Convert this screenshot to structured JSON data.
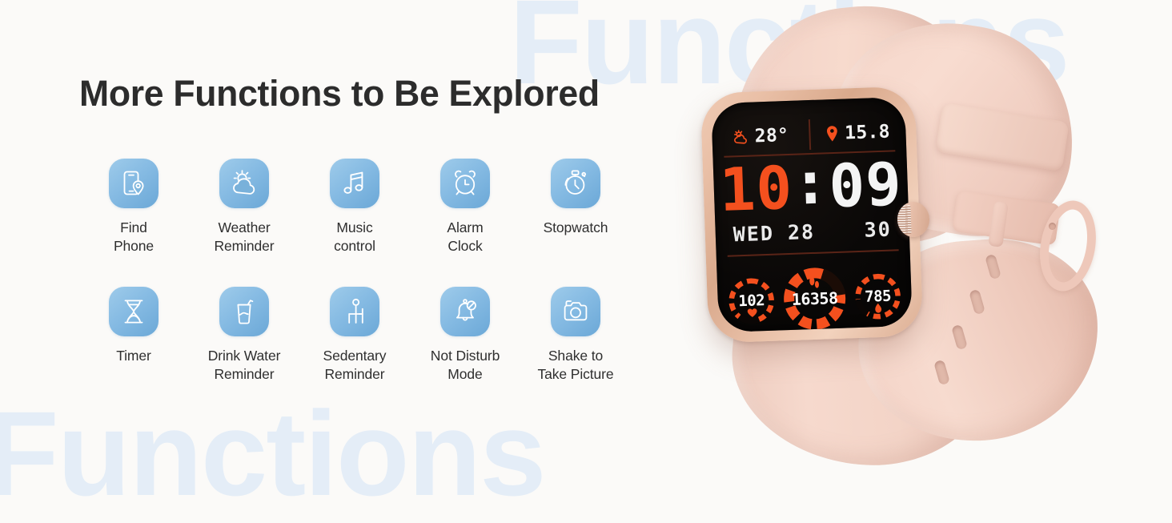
{
  "background": {
    "color": "#fbfaf8",
    "watermark_text_top": "Functions",
    "watermark_text_bottom": "Functions",
    "watermark_color": "#dce9f7"
  },
  "header": {
    "title": "More Functions to Be Explored",
    "title_color": "#2c2c2c"
  },
  "theme": {
    "icon_gradient_start": "#9ecbea",
    "icon_gradient_end": "#6ba8d7",
    "icon_glyph_color": "#ffffff",
    "watch_accent": "#f4501e",
    "watch_band": "#f2d2c6",
    "watch_case": "#e1b296"
  },
  "features": [
    {
      "icon": "find-phone-icon",
      "label": "Find\nPhone"
    },
    {
      "icon": "weather-reminder-icon",
      "label": "Weather\nReminder"
    },
    {
      "icon": "music-control-icon",
      "label": "Music\ncontrol"
    },
    {
      "icon": "alarm-clock-icon",
      "label": "Alarm\nClock"
    },
    {
      "icon": "stopwatch-icon",
      "label": "Stopwatch"
    },
    {
      "icon": "timer-icon",
      "label": "Timer"
    },
    {
      "icon": "drink-water-reminder-icon",
      "label": "Drink Water\nReminder"
    },
    {
      "icon": "sedentary-reminder-icon",
      "label": "Sedentary\nReminder"
    },
    {
      "icon": "not-disturb-mode-icon",
      "label": "Not Disturb\nMode"
    },
    {
      "icon": "shake-to-take-picture-icon",
      "label": "Shake to\nTake Picture"
    }
  ],
  "watch": {
    "weather": {
      "icon": "sun-cloud-icon",
      "temperature": "28°"
    },
    "location": {
      "icon": "location-pin-icon",
      "value": "15.8"
    },
    "time": {
      "hours": "10",
      "separator": ":",
      "minutes": "09"
    },
    "date": "WED 28",
    "extra": "30",
    "metrics": [
      {
        "icon": "heart-icon",
        "value": "102",
        "name": "heart-rate"
      },
      {
        "icon": "footstep-icon",
        "value": "16358",
        "name": "steps"
      },
      {
        "icon": "flame-icon",
        "value": "785",
        "name": "calories"
      }
    ]
  }
}
